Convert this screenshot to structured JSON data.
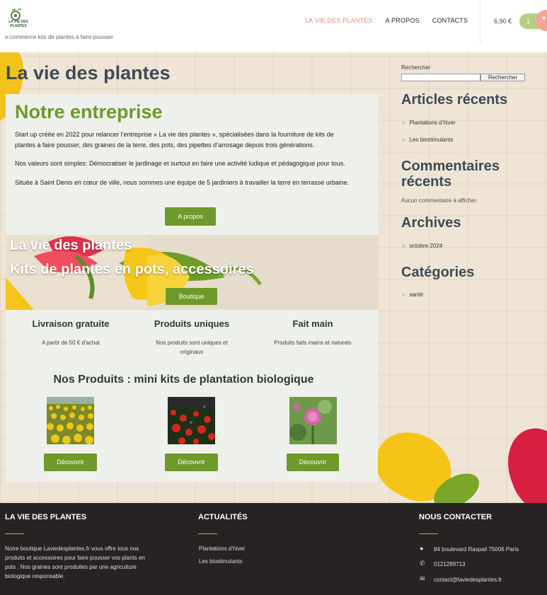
{
  "header": {
    "logo_text": "LA VIE DES PLANTES",
    "tagline": "e-commerce kits de plantes à faire pousser",
    "nav": [
      {
        "label": "LA VIE DES PLANTES",
        "active": true
      },
      {
        "label": "A PROPOS",
        "active": false
      },
      {
        "label": "CONTACTS",
        "active": false
      }
    ],
    "cart_total": "6,90 €",
    "cart_count": "1",
    "cart_icon": "cart-icon"
  },
  "main": {
    "page_title": "La vie des plantes",
    "about": {
      "title": "Notre entreprise",
      "paragraphs": [
        "Start up créée en 2022 pour relancer l’entreprise « La vie des plantes »,  spécialisées dans la fourniture de kits de plantes à faire pousser, des graines de la terre, des pots, des pipettes d’arrosage depuis trois générations.",
        "Nos valeurs sont simples: Démocratiser le jardinage et surtout en faire une activité ludique et pédagogique pour tous.",
        "Située à Saint Denis en cœur de ville, nous sommes une équipe de 5 jardiniers à travailler la terre en terrasse urbaine."
      ],
      "button": "A propos"
    },
    "banner": {
      "line1": "La vie des plantes",
      "line2": "Kits de plantes en pots, accessoires",
      "button": "Boutique"
    },
    "features": [
      {
        "title": "Livraison gratuite",
        "text": "A partir de 50 € d'achat"
      },
      {
        "title": "Produits uniques",
        "text": "Nos produits sont uniques et originaux"
      },
      {
        "title": "Fait main",
        "text": "Produits faits mains et naturels"
      }
    ],
    "products_heading": "Nos Produits : mini kits de plantation biologique",
    "products": [
      {
        "image": "sunflower-field",
        "button": "Découvrir"
      },
      {
        "image": "red-poppies",
        "button": "Découvrir"
      },
      {
        "image": "pink-clover-flower",
        "button": "Découvrir"
      }
    ]
  },
  "sidebar": {
    "search_label": "Rechercher",
    "search_value": "",
    "search_button": "Rechercher",
    "recent_posts_title": "Articles récents",
    "recent_posts": [
      "Plantations d’hiver",
      "Les biostimulants"
    ],
    "recent_comments_title": "Commentaires récents",
    "no_comments": "Aucun commentaire à afficher.",
    "archives_title": "Archives",
    "archives": [
      "octobre 2024"
    ],
    "categories_title": "Catégories",
    "categories": [
      "santé"
    ]
  },
  "footer": {
    "col1_title": "LA VIE DES PLANTES",
    "col1_text": "Notre boutique Laviedesplantes.fr vous offre tous nos produits et accessoires pour faire pousser vos plants en pots . Nos graines sont produites par une agriculture biologique responsable.",
    "col2_title": "ACTUALITÉS",
    "col2_links": [
      "Plantations d’hiver",
      "Les biostimulants"
    ],
    "col3_title": "NOUS CONTACTER",
    "address": "84 boulevard Raspail 75006 Paris",
    "phone": "0121289713",
    "email": "contact@laviedesplantes.fr"
  },
  "colors": {
    "accent_green": "#6d9a2a",
    "accent_pink": "#e58c7b",
    "footer_bg": "#272322",
    "heading_gray": "#404a55"
  }
}
